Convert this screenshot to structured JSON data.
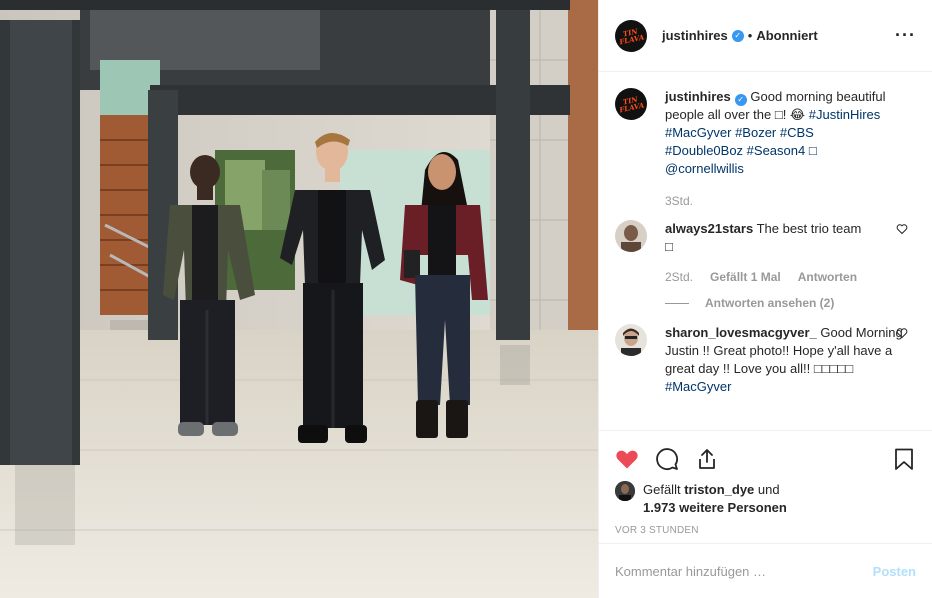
{
  "header": {
    "username": "justinhires",
    "separator": "•",
    "follow_status": "Abonniert",
    "more_icon": "more-horizontal-icon",
    "avatar_text": "TIN FLAVA"
  },
  "caption": {
    "username": "justinhires",
    "text_pre": "Good morning beautiful people all over the □! 😂",
    "hashtags_line1": "#JustinHires",
    "hashtags_line2": "#MacGyver #Bozer #CBS",
    "hashtags_line3": "#Double0Boz #Season4 □",
    "mention": "@cornellwillis",
    "time": "3Std."
  },
  "comments": [
    {
      "username": "always21stars",
      "text": "The best trio team",
      "text2": "□",
      "time": "2Std.",
      "likes": "Gefällt 1 Mal",
      "reply_label": "Antworten",
      "view_replies": "Antworten ansehen (2)"
    },
    {
      "username": "sharon_lovesmacgyver_",
      "text": "Good Morning Justin !! Great photo!! Hope y'all have a great day !! Love you all!! □□□□□",
      "hashtag": "#MacGyver"
    }
  ],
  "actions": {
    "like_icon": "heart-filled-icon",
    "comment_icon": "comment-icon",
    "share_icon": "share-icon",
    "save_icon": "bookmark-icon",
    "liked": true
  },
  "likes": {
    "prefix": "Gefällt",
    "user": "triston_dye",
    "connector": "und",
    "others": "1.973 weitere Personen"
  },
  "timestamp": "VOR 3 STUNDEN",
  "add_comment": {
    "placeholder": "Kommentar hinzufügen …",
    "post_label": "Posten"
  },
  "colors": {
    "like_red": "#ed4956",
    "link_blue": "#003569",
    "verified_blue": "#3897f0",
    "post_disabled": "#b2dffc"
  }
}
